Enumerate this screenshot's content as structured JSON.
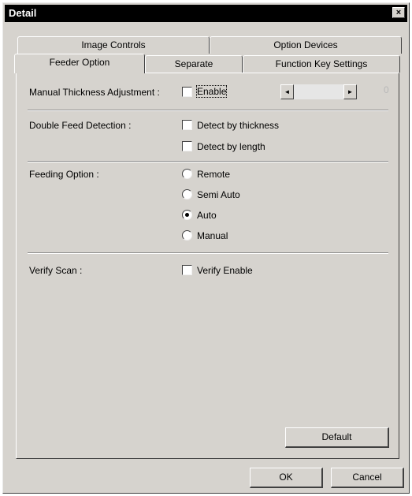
{
  "window": {
    "title": "Detail",
    "close_glyph": "×"
  },
  "tabs": {
    "back_row": [
      "Image Controls",
      "Option Devices"
    ],
    "front_row": [
      "Feeder Option",
      "Separate",
      "Function Key Settings"
    ],
    "active": "Feeder Option"
  },
  "manual_thickness": {
    "label": "Manual Thickness Adjustment :",
    "checkbox_label": "Enable",
    "checked": false,
    "scroll_left_icon": "arrow-left-icon",
    "scroll_right_icon": "arrow-right-icon",
    "left_glyph": "◄",
    "right_glyph": "►",
    "value_glyph": "0"
  },
  "double_feed": {
    "label": "Double Feed Detection :",
    "options": [
      {
        "label": "Detect by thickness",
        "checked": false
      },
      {
        "label": "Detect by length",
        "checked": false
      }
    ]
  },
  "feeding_option": {
    "label": "Feeding Option :",
    "options": [
      {
        "label": "Remote",
        "selected": false
      },
      {
        "label": "Semi Auto",
        "selected": false
      },
      {
        "label": "Auto",
        "selected": true
      },
      {
        "label": "Manual",
        "selected": false
      }
    ]
  },
  "verify_scan": {
    "label": "Verify Scan :",
    "checkbox_label": "Verify Enable",
    "checked": false
  },
  "buttons": {
    "default": "Default",
    "ok": "OK",
    "cancel": "Cancel"
  },
  "colors": {
    "face": "#d6d3ce",
    "titlebar": "#000000",
    "shadow": "#404040",
    "highlight": "#ffffff"
  }
}
